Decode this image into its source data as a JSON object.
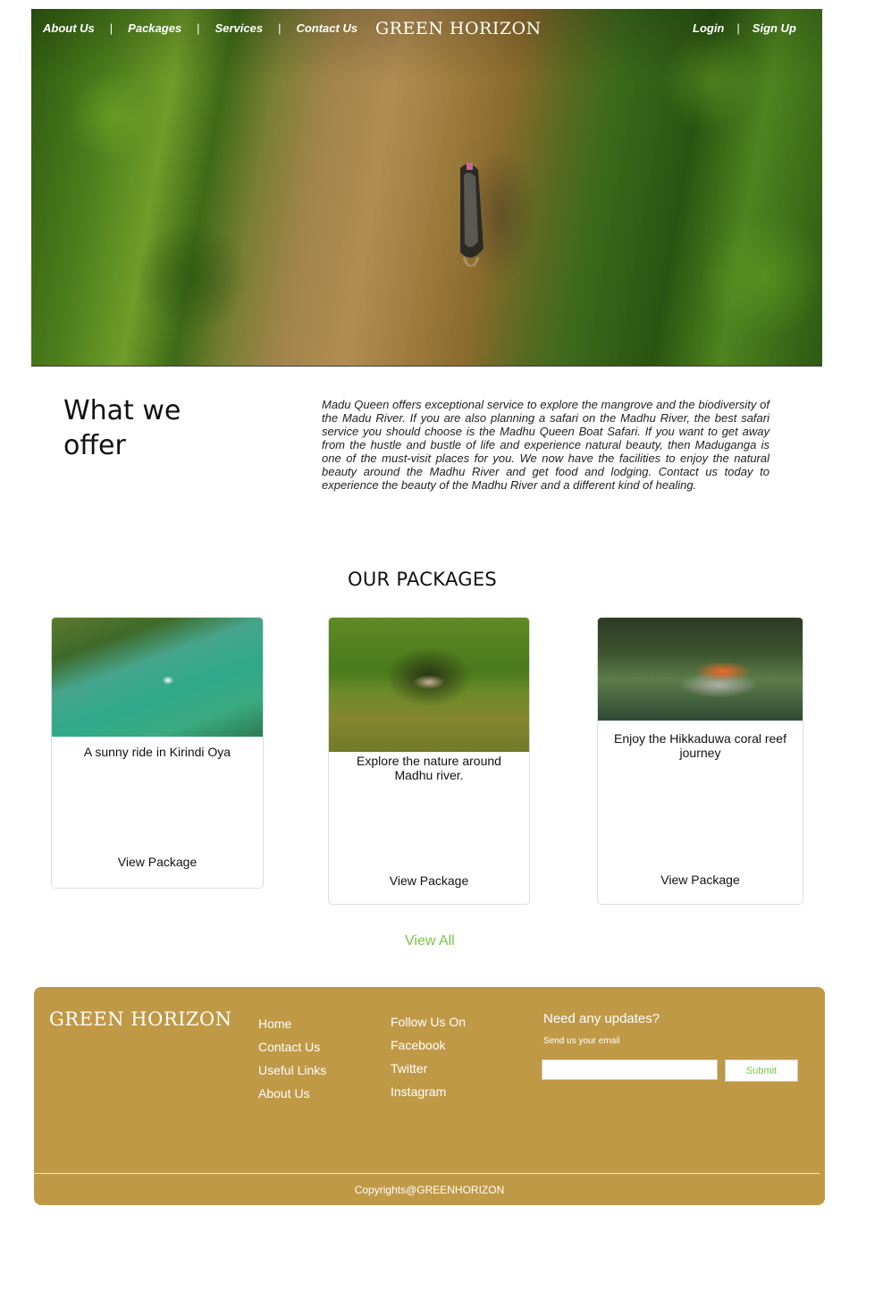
{
  "header": {
    "nav": [
      "About Us",
      "Packages",
      "Services",
      "Contact Us"
    ],
    "separator": "|",
    "brand": "GREEN HORIZON",
    "auth": {
      "login": "Login",
      "signup": "Sign Up"
    }
  },
  "offer": {
    "title": "What we offer",
    "text": "Madu Queen offers exceptional service to explore the mangrove and the biodiversity of the Madu River. If you are also planning a safari on the Madhu River, the best safari service you should choose is the Madhu Queen Boat Safari. If you want to get away from the hustle and bustle of life and experience natural beauty, then Maduganga is one of the must-visit places for you. We now have the facilities to enjoy the natural beauty around the Madhu River and get food and lodging. Contact us today to experience the beauty of the Madhu River and a different kind of healing."
  },
  "packages": {
    "title": "OUR PACKAGES",
    "items": [
      {
        "title": "A sunny ride in Kirindi Oya",
        "button": "View Package"
      },
      {
        "title": "Explore the nature around Madhu river.",
        "button": "View Package"
      },
      {
        "title": "Enjoy the Hikkaduwa coral reef journey",
        "button": "View Package"
      }
    ],
    "view_all": "View All"
  },
  "footer": {
    "brand": "GREEN HORIZON",
    "links": [
      "Home",
      "Contact Us",
      "Useful Links",
      "About Us"
    ],
    "social": [
      "Follow Us On",
      "Facebook",
      "Twitter",
      "Instagram"
    ],
    "updates_title": "Need any updates?",
    "email_label": "Send us your email",
    "email_value": "",
    "submit": "Submit",
    "copyright": "Copyrights@GREENHORIZON"
  },
  "colors": {
    "footer_bg": "#bf9946",
    "accent_green": "#7cc24a",
    "text": "#111111"
  }
}
